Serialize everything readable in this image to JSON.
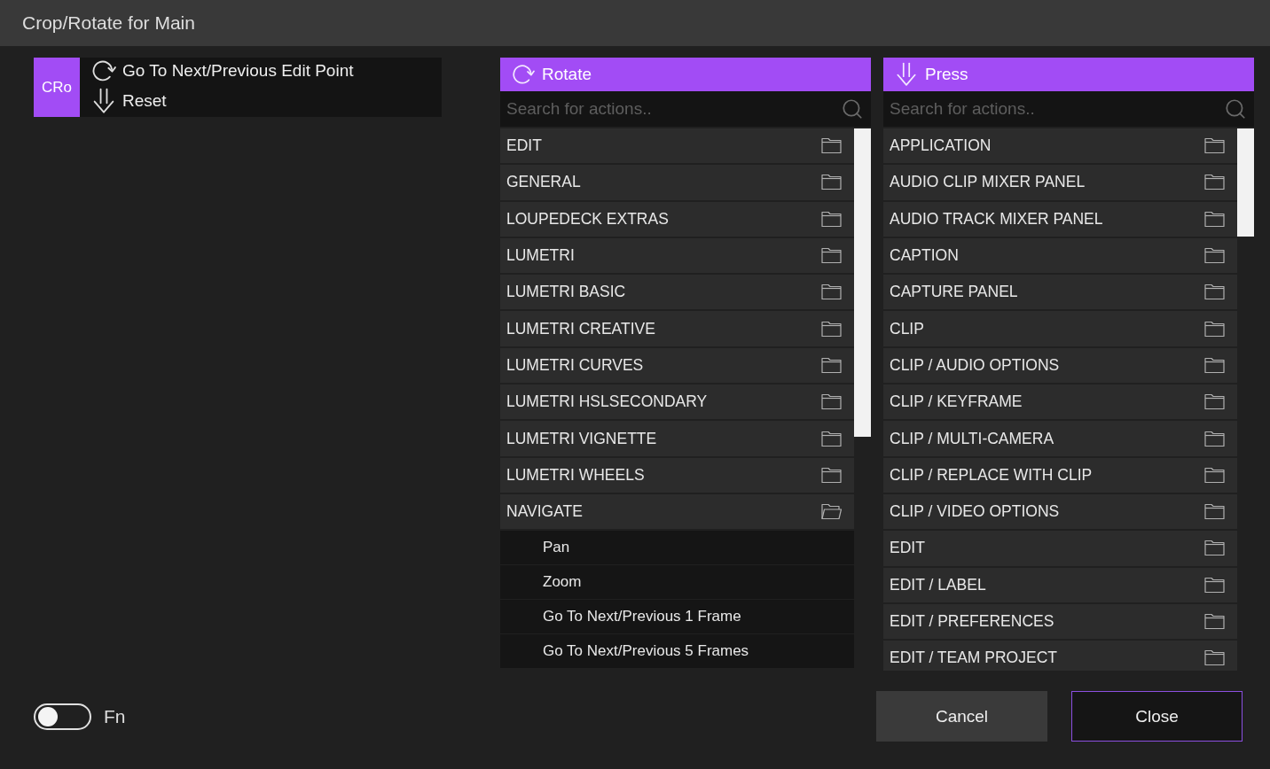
{
  "window": {
    "title": "Crop/Rotate for Main"
  },
  "assignment": {
    "badge": "CRo",
    "actions": [
      {
        "kind": "rotate",
        "label": "Go To Next/Previous Edit Point"
      },
      {
        "kind": "press",
        "label": "Reset"
      }
    ]
  },
  "panels": [
    {
      "kind": "rotate",
      "title": "Rotate",
      "search": {
        "placeholder": "Search for actions.."
      },
      "items": [
        {
          "label": "EDIT",
          "expanded": false
        },
        {
          "label": "GENERAL",
          "expanded": false
        },
        {
          "label": "LOUPEDECK EXTRAS",
          "expanded": false
        },
        {
          "label": "LUMETRI",
          "expanded": false
        },
        {
          "label": "LUMETRI BASIC",
          "expanded": false
        },
        {
          "label": "LUMETRI CREATIVE",
          "expanded": false
        },
        {
          "label": "LUMETRI CURVES",
          "expanded": false
        },
        {
          "label": "LUMETRI HSLSECONDARY",
          "expanded": false
        },
        {
          "label": "LUMETRI VIGNETTE",
          "expanded": false
        },
        {
          "label": "LUMETRI WHEELS",
          "expanded": false
        },
        {
          "label": "NAVIGATE",
          "expanded": true,
          "children": [
            {
              "label": "Pan"
            },
            {
              "label": "Zoom"
            },
            {
              "label": "Go To Next/Previous 1 Frame"
            },
            {
              "label": "Go To Next/Previous 5 Frames"
            }
          ]
        }
      ]
    },
    {
      "kind": "press",
      "title": "Press",
      "search": {
        "placeholder": "Search for actions.."
      },
      "items": [
        {
          "label": "APPLICATION",
          "expanded": false
        },
        {
          "label": "AUDIO CLIP MIXER PANEL",
          "expanded": false
        },
        {
          "label": "AUDIO TRACK MIXER PANEL",
          "expanded": false
        },
        {
          "label": "CAPTION",
          "expanded": false
        },
        {
          "label": "CAPTURE PANEL",
          "expanded": false
        },
        {
          "label": "CLIP",
          "expanded": false
        },
        {
          "label": "CLIP / AUDIO OPTIONS",
          "expanded": false
        },
        {
          "label": "CLIP / KEYFRAME",
          "expanded": false
        },
        {
          "label": "CLIP / MULTI-CAMERA",
          "expanded": false
        },
        {
          "label": "CLIP / REPLACE WITH CLIP",
          "expanded": false
        },
        {
          "label": "CLIP / VIDEO OPTIONS",
          "expanded": false
        },
        {
          "label": "EDIT",
          "expanded": false
        },
        {
          "label": "EDIT / LABEL",
          "expanded": false
        },
        {
          "label": "EDIT / PREFERENCES",
          "expanded": false
        },
        {
          "label": "EDIT / TEAM PROJECT",
          "expanded": false
        }
      ]
    }
  ],
  "footer": {
    "fn_toggle": {
      "label": "Fn",
      "on": false
    },
    "buttons": [
      {
        "kind": "secondary",
        "label": "Cancel"
      },
      {
        "kind": "primary",
        "label": "Close"
      }
    ]
  }
}
